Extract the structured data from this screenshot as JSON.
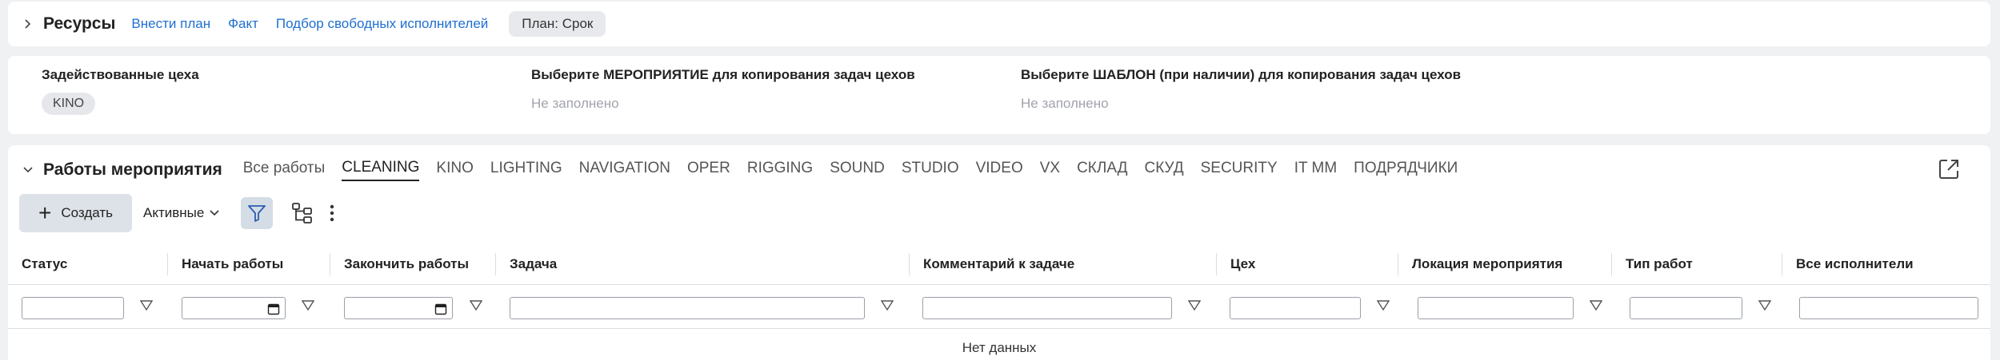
{
  "resources": {
    "title": "Ресурсы",
    "links": [
      "Внести план",
      "Факт",
      "Подбор свободных исполнителей"
    ],
    "plan_badge": "План: Срок"
  },
  "workshops": {
    "involved_label": "Задействованные цеха",
    "involved_tag": "KINO",
    "event_label": "Выберите МЕРОПРИЯТИЕ для копирования задач цехов",
    "event_value": "Не заполнено",
    "template_label": "Выберите ШАБЛОН (при наличии) для копирования задач цехов",
    "template_value": "Не заполнено"
  },
  "works": {
    "title": "Работы мероприятия",
    "tabs": [
      "Все работы",
      "CLEANING",
      "KINO",
      "LIGHTING",
      "NAVIGATION",
      "OPER",
      "RIGGING",
      "SOUND",
      "STUDIO",
      "VIDEO",
      "VX",
      "СКЛАД",
      "СКУД",
      "SECURITY",
      "IT MM",
      "ПОДРЯДЧИКИ"
    ],
    "active_tab": "CLEANING",
    "create_label": "Создать",
    "filter_dropdown": "Активные",
    "columns": [
      "Статус",
      "Начать работы",
      "Закончить работы",
      "Задача",
      "Комментарий к задаче",
      "Цех",
      "Локация мероприятия",
      "Тип работ",
      "Все исполнители"
    ],
    "empty_text": "Нет данных"
  },
  "colors": {
    "accent_link": "#1f6fd1",
    "background": "#f0f1f3",
    "filter_active_bg": "#d4dce6"
  },
  "icons": [
    "chevron-right-icon",
    "chevron-down-icon",
    "plus-icon",
    "filter-icon",
    "tree-icon",
    "more-vertical-icon",
    "external-link-icon",
    "calendar-icon",
    "filter-triangle-icon"
  ]
}
